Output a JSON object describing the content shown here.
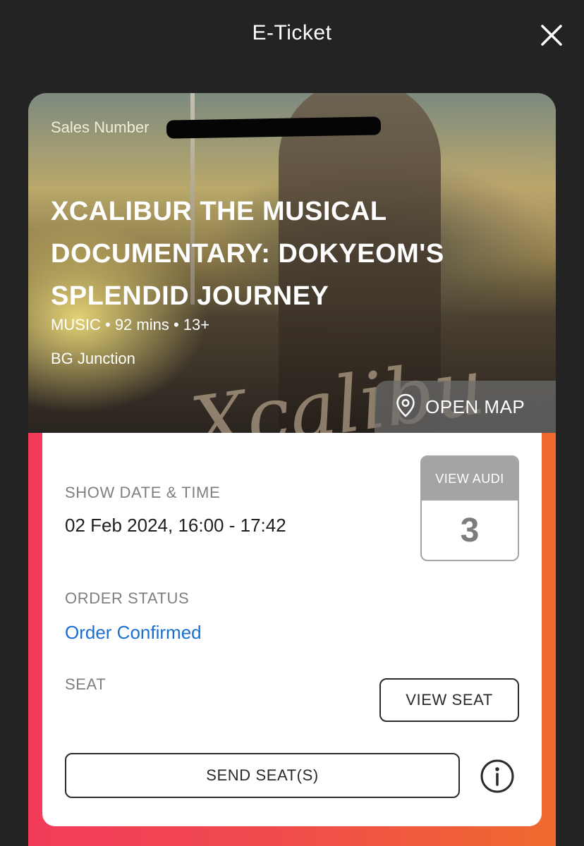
{
  "header": {
    "title": "E-Ticket",
    "close_icon": "close-icon"
  },
  "hero": {
    "sales_number_label": "Sales Number",
    "movie_title": "XCALIBUR THE MUSICAL DOCUMENTARY: DOKYEOM'S SPLENDID JOURNEY",
    "meta": "MUSIC • 92 mins • 13+",
    "venue": "BG Junction",
    "open_map_label": "OPEN MAP",
    "poster_script_text": "Xcalibu",
    "pin_icon": "map-pin-icon"
  },
  "details": {
    "show_label": "SHOW DATE & TIME",
    "show_value": "02 Feb 2024, 16:00 - 17:42",
    "audi_label": "VIEW AUDI",
    "audi_number": "3",
    "order_label": "ORDER STATUS",
    "order_value": "Order Confirmed",
    "seat_label": "SEAT",
    "seat_value": "",
    "view_seat_label": "VIEW SEAT",
    "send_seats_label": "SEND SEAT(S)",
    "info_icon": "info-icon"
  },
  "colors": {
    "background": "#232323",
    "gradient_start": "#f23c5a",
    "gradient_end": "#ef6a2e",
    "order_status": "#1a6fd1",
    "audi_box": "#a4a4a4"
  }
}
